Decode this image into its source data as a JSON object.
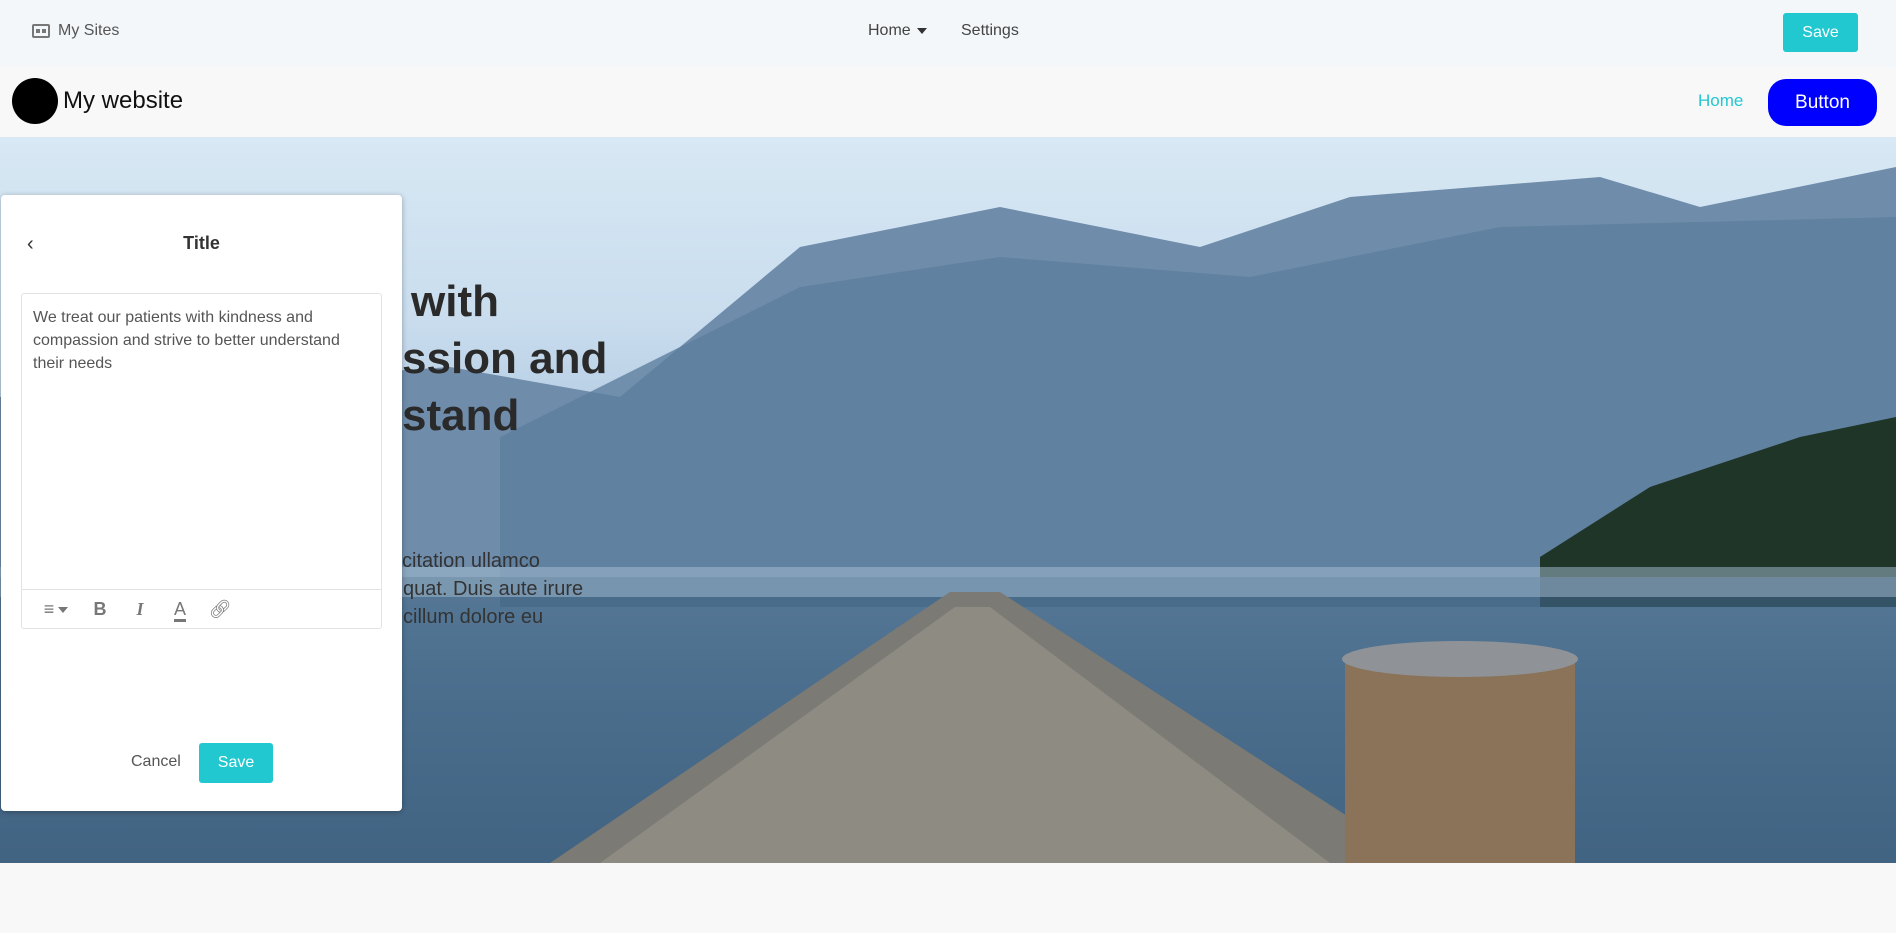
{
  "topbar": {
    "my_sites": "My Sites",
    "nav": [
      {
        "label": "Home"
      },
      {
        "label": "Settings"
      }
    ],
    "save": "Save"
  },
  "site": {
    "name": "My website",
    "nav_home": "Home",
    "button": "Button"
  },
  "hero": {
    "heading_lines": [
      "with",
      "ssion and",
      "stand"
    ],
    "paragraph_lines": [
      "citation ullamco",
      "quat. Duis aute irure",
      "cillum dolore eu"
    ]
  },
  "panel": {
    "back_icon": "chevron-left-icon",
    "title": "Title",
    "text": "We treat our patients with kindness and compassion and strive to better understand their needs",
    "toolbar": [
      "align-left-icon",
      "bold-icon",
      "italic-icon",
      "text-color-icon",
      "link-icon"
    ],
    "cancel": "Cancel",
    "save": "Save"
  },
  "colors": {
    "accent": "#22c8d0",
    "site_button": "#0000ff"
  }
}
